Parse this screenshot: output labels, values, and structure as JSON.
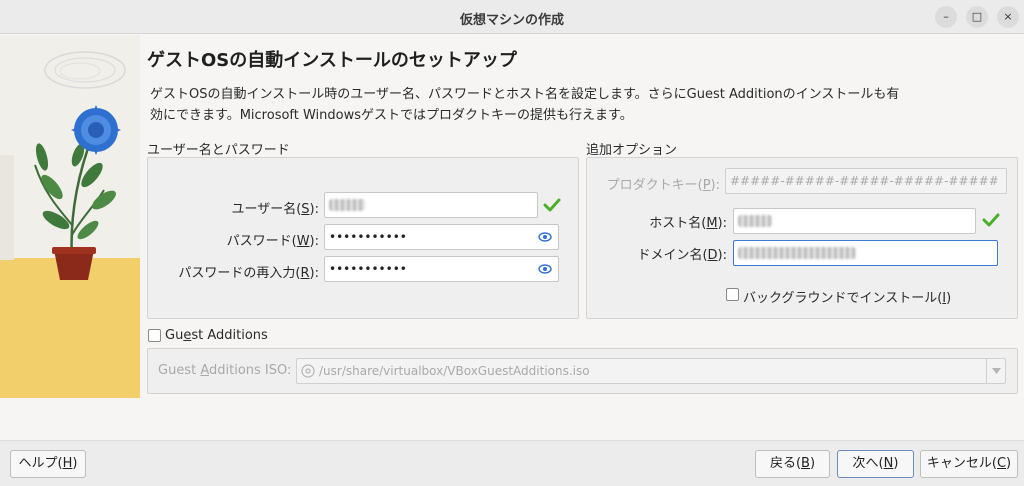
{
  "window": {
    "title": "仮想マシンの作成",
    "minimize_glyph": "–",
    "maximize_glyph": "□",
    "close_glyph": "×"
  },
  "page": {
    "heading": "ゲストOSの自動インストールのセットアップ",
    "description": "ゲストOSの自動インストール時のユーザー名、パスワードとホスト名を設定します。さらにGuest Additionのインストールも有効にできます。Microsoft Windowsゲストではプロダクトキーの提供も行えます。"
  },
  "user_group": {
    "label": "ユーザー名とパスワード",
    "username_label": "ユーザー名(",
    "username_mnemonic": "S",
    "password_label": "パスワード(",
    "password_mnemonic": "W",
    "password_value": "•••••••••••",
    "repeat_label": "パスワードの再入力(",
    "repeat_mnemonic": "R",
    "repeat_value": "•••••••••••",
    "label_close": "):"
  },
  "extra_group": {
    "label": "追加オプション",
    "product_key_label": "プロダクトキー(",
    "product_key_mnemonic": "P",
    "product_key_placeholder": "#####-#####-#####-#####-#####",
    "hostname_label": "ホスト名(",
    "hostname_mnemonic": "M",
    "domain_label": "ドメイン名(",
    "domain_mnemonic": "D",
    "label_close": "):",
    "background_install_label": "バックグラウンドでインストール(",
    "background_install_mnemonic": "I",
    "background_install_close": ")"
  },
  "guest_additions": {
    "checkbox_label_pre": "Gu",
    "checkbox_label_mnemonic": "e",
    "checkbox_label_post": "st Additions",
    "iso_label_pre": "Guest ",
    "iso_label_mnemonic": "A",
    "iso_label_post": "dditions ISO:",
    "iso_path": "/usr/share/virtualbox/VBoxGuestAdditions.iso"
  },
  "footer": {
    "help_label": "ヘルプ(",
    "help_mnemonic": "H",
    "back_label": "戻る(",
    "back_mnemonic": "B",
    "next_label": "次へ(",
    "next_mnemonic": "N",
    "cancel_label": "キャンセル(",
    "cancel_mnemonic": "C",
    "close_paren": ")"
  },
  "colors": {
    "check_green": "#4caf2a",
    "focus_blue": "#3d7bd2",
    "flower_blue": "#2f6fd0",
    "floor_yellow": "#f3cf6b"
  }
}
